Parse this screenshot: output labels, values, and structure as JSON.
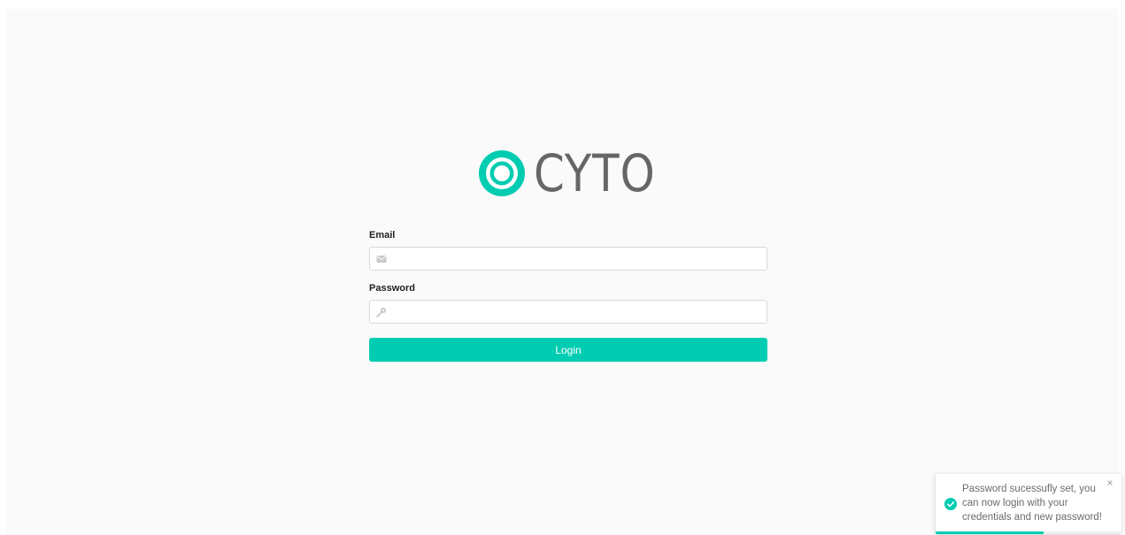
{
  "brand": {
    "name": "CYTO",
    "accent_color": "#00ccb1",
    "logo_icon": "concentric-ring-icon"
  },
  "form": {
    "email_label": "Email",
    "email_value": "",
    "email_placeholder": "",
    "email_icon": "envelope-icon",
    "password_label": "Password",
    "password_value": "",
    "password_placeholder": "",
    "password_icon": "key-icon",
    "login_label": "Login"
  },
  "toast": {
    "message": "Password sucessufly set, you can now login with your credentials and new password!",
    "status_icon": "success-check-icon",
    "close_icon": "close-icon",
    "close_glyph": "×",
    "progress": 0.58
  }
}
